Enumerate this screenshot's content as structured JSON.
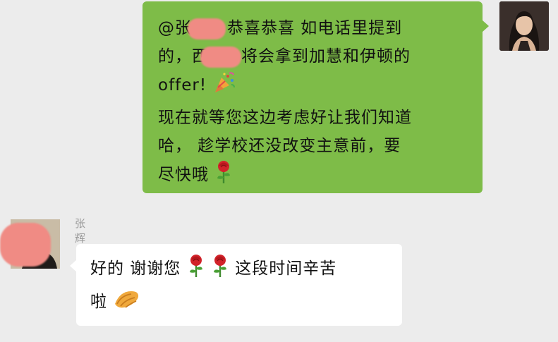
{
  "outgoing": {
    "lines": [
      {
        "pre": "@张",
        "post": "恭喜恭喜  如电话里提到"
      },
      {
        "pre": "的，西",
        "post": "将会拿到加慧和伊顿的"
      },
      {
        "pre": "offer!",
        "post": ""
      },
      {
        "pre": "现在就等您这边考虑好让我们知道",
        "post": ""
      },
      {
        "pre": "哈， 趁学校还没改变主意前，要",
        "post": ""
      },
      {
        "pre": "尽快哦",
        "post": ""
      }
    ],
    "emoji": [
      "party-popper-icon",
      "rose-icon"
    ],
    "bubble_color": "#7ebc48"
  },
  "incoming": {
    "sender_name": "张辉",
    "lines": [
      {
        "pre": "好的 谢谢您",
        "post": " 这段时间辛苦"
      },
      {
        "pre": "啦",
        "post": ""
      }
    ],
    "emoji": [
      "rose-icon",
      "rose-icon",
      "bread-icon"
    ],
    "bubble_color": "#ffffff"
  },
  "colors": {
    "background": "#ececec",
    "redaction": "#f08b84",
    "name_text": "#9a9a9a"
  }
}
